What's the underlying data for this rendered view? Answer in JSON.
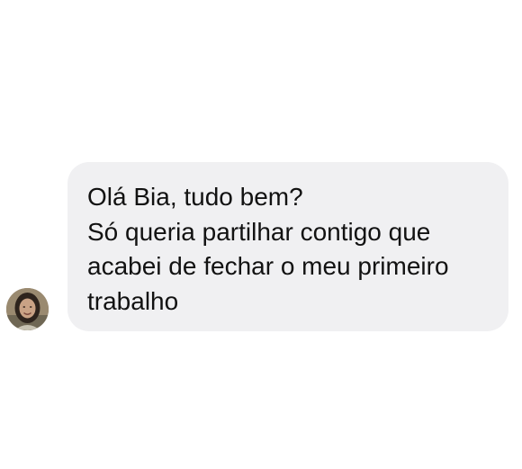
{
  "conversation": {
    "message": {
      "lines": [
        "Olá Bia, tudo bem?",
        "Só queria partilhar contigo que",
        "acabei de fechar o meu primeiro",
        "trabalho"
      ],
      "sender_avatar_icon": "user-avatar-photo"
    },
    "colors": {
      "background": "#ffffff",
      "bubble": "#f0f0f2",
      "text": "#121212"
    }
  }
}
